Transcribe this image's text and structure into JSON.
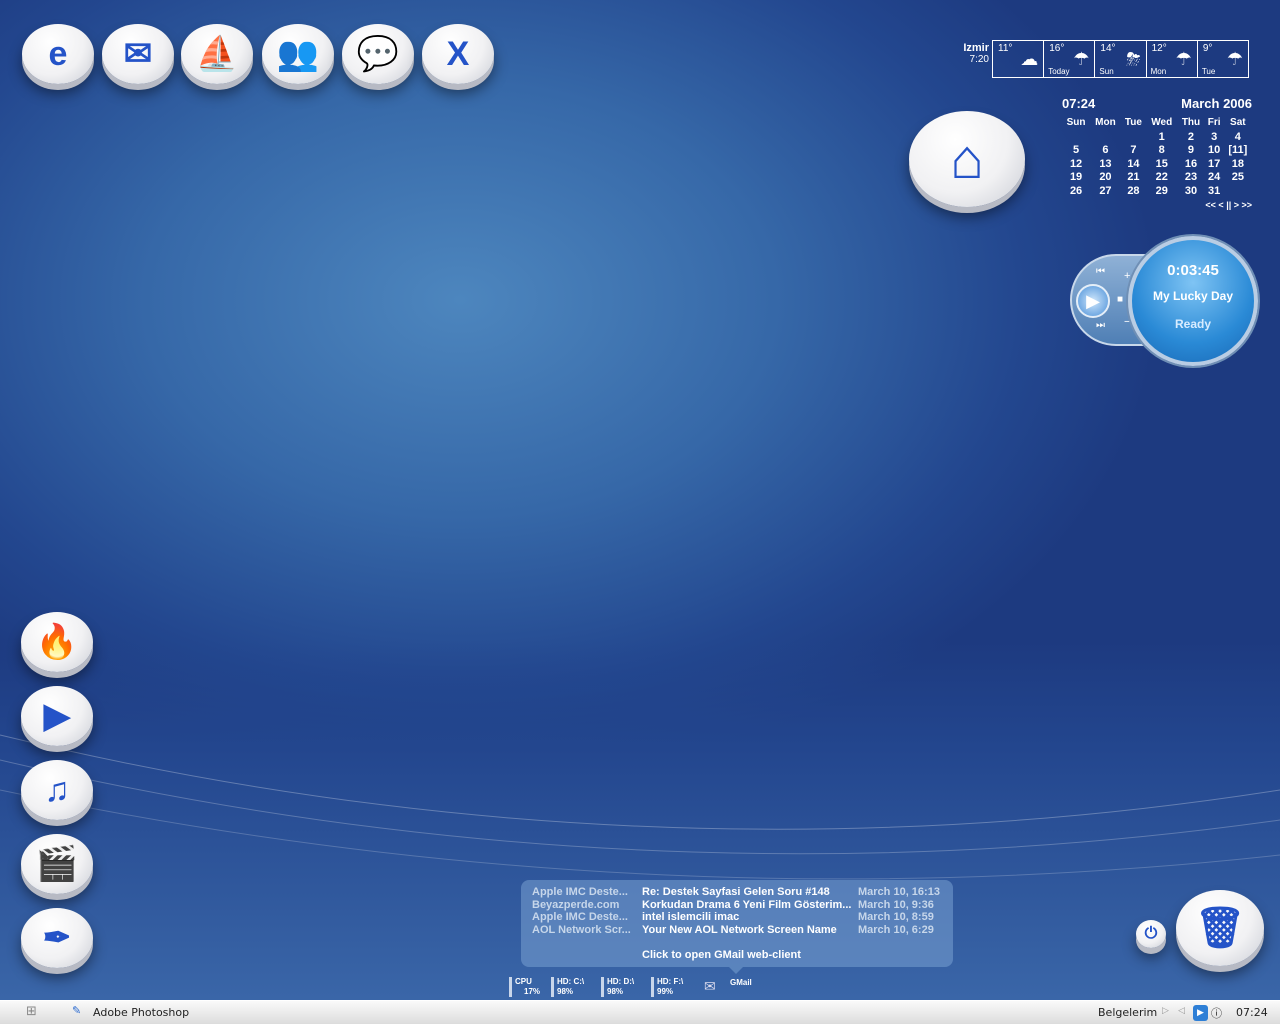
{
  "desktop_icons_top": [
    {
      "name": "internet-explorer",
      "glyph": "e"
    },
    {
      "name": "mail",
      "glyph": "✉"
    },
    {
      "name": "firefox-like",
      "glyph": "⛵"
    },
    {
      "name": "messenger",
      "glyph": "👥"
    },
    {
      "name": "chat",
      "glyph": "💬"
    },
    {
      "name": "divx",
      "glyph": "X"
    }
  ],
  "desktop_icons_left": [
    {
      "name": "burn",
      "glyph": "🔥"
    },
    {
      "name": "media-player",
      "glyph": "▶"
    },
    {
      "name": "music",
      "glyph": "♫"
    },
    {
      "name": "video",
      "glyph": "🎬"
    },
    {
      "name": "quill",
      "glyph": "✒"
    }
  ],
  "weather": {
    "city": "Izmir",
    "time": "7:20",
    "days": [
      {
        "temp": "11°",
        "label": "",
        "icon": "☁"
      },
      {
        "temp": "16°",
        "label": "Today",
        "icon": "☂"
      },
      {
        "temp": "14°",
        "label": "Sun",
        "icon": "⛈"
      },
      {
        "temp": "12°",
        "label": "Mon",
        "icon": "☂"
      },
      {
        "temp": "9°",
        "label": "Tue",
        "icon": "☂"
      }
    ]
  },
  "calendar": {
    "time": "07:24",
    "month": "March 2006",
    "headers": [
      "Sun",
      "Mon",
      "Tue",
      "Wed",
      "Thu",
      "Fri",
      "Sat"
    ],
    "weeks": [
      [
        "",
        "",
        "",
        "1",
        "2",
        "3",
        "4"
      ],
      [
        "5",
        "6",
        "7",
        "8",
        "9",
        "10",
        "[11]"
      ],
      [
        "12",
        "13",
        "14",
        "15",
        "16",
        "17",
        "18"
      ],
      [
        "19",
        "20",
        "21",
        "22",
        "23",
        "24",
        "25"
      ],
      [
        "26",
        "27",
        "28",
        "29",
        "30",
        "31",
        ""
      ]
    ],
    "nav": "<< < || > >>"
  },
  "player": {
    "time": "0:03:45",
    "track": "My Lucky Day",
    "status": "Ready"
  },
  "mail": {
    "items": [
      {
        "from": "Apple IMC Deste...",
        "subject": "Re: Destek Sayfasi Gelen Soru #148",
        "date": "March 10, 16:13"
      },
      {
        "from": "Beyazperde.com",
        "subject": "Korkudan Drama 6 Yeni Film Gösterim...",
        "date": "March 10, 9:36"
      },
      {
        "from": "Apple IMC Deste...",
        "subject": "intel islemcili imac",
        "date": "March 10, 8:59"
      },
      {
        "from": "AOL Network Scr...",
        "subject": "Your New AOL Network Screen Name",
        "date": "March 10, 6:29"
      }
    ],
    "open_label": "Click to open GMail web-client"
  },
  "stats": [
    {
      "label": "CPU",
      "value": "17%"
    },
    {
      "label": "HD: C:\\",
      "value": "98%"
    },
    {
      "label": "HD: D:\\",
      "value": "98%"
    },
    {
      "label": "HD: F:\\",
      "value": "99%"
    }
  ],
  "gmail_label": "GMail",
  "taskbar": {
    "task": "Adobe Photoshop",
    "folder": "Belgelerim",
    "clock": "07:24"
  }
}
